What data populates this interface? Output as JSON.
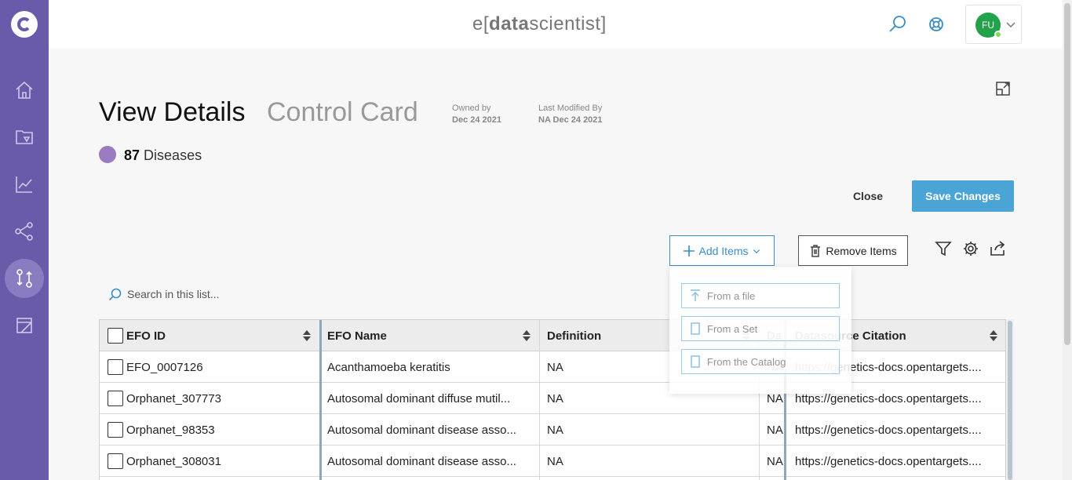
{
  "topbar": {
    "brand_e": "e",
    "brand_open": "[",
    "brand_data": "data",
    "brand_scientist": "scientist",
    "brand_close": "]",
    "user_initials": "FU"
  },
  "header": {
    "title": "View Details",
    "subtitle": "Control Card",
    "owned_label": "Owned by",
    "owned_value": "Dec 24 2021",
    "modified_label": "Last Modified By",
    "modified_value": "NA Dec 24 2021",
    "count_value": "87",
    "count_label": "Diseases",
    "count_color": "#9b7bc0"
  },
  "actions": {
    "close_label": "Close",
    "save_label": "Save Changes",
    "add_label": "Add Items",
    "remove_label": "Remove Items"
  },
  "add_menu": {
    "items": [
      "From a file",
      "From a Set",
      "From the Catalog"
    ]
  },
  "search": {
    "placeholder": "Search in this list..."
  },
  "table": {
    "columns": [
      "EFO ID",
      "EFO Name",
      "Definition",
      "Da",
      "Datasource Citation"
    ],
    "rows": [
      [
        "EFO_0007126",
        "Acanthamoeba keratitis",
        "NA",
        "NA",
        "https://genetics-docs.opentargets...."
      ],
      [
        "Orphanet_307773",
        "Autosomal dominant diffuse mutil...",
        "NA",
        "NA",
        "https://genetics-docs.opentargets...."
      ],
      [
        "Orphanet_98353",
        "Autosomal dominant disease asso...",
        "NA",
        "NA",
        "https://genetics-docs.opentargets...."
      ],
      [
        "Orphanet_308031",
        "Autosomal dominant disease asso...",
        "NA",
        "NA",
        "https://genetics-docs.opentargets...."
      ]
    ]
  },
  "colors": {
    "sidebar": "#6a5aaa",
    "accent": "#4aa4d6",
    "avatar": "#22a24a"
  }
}
